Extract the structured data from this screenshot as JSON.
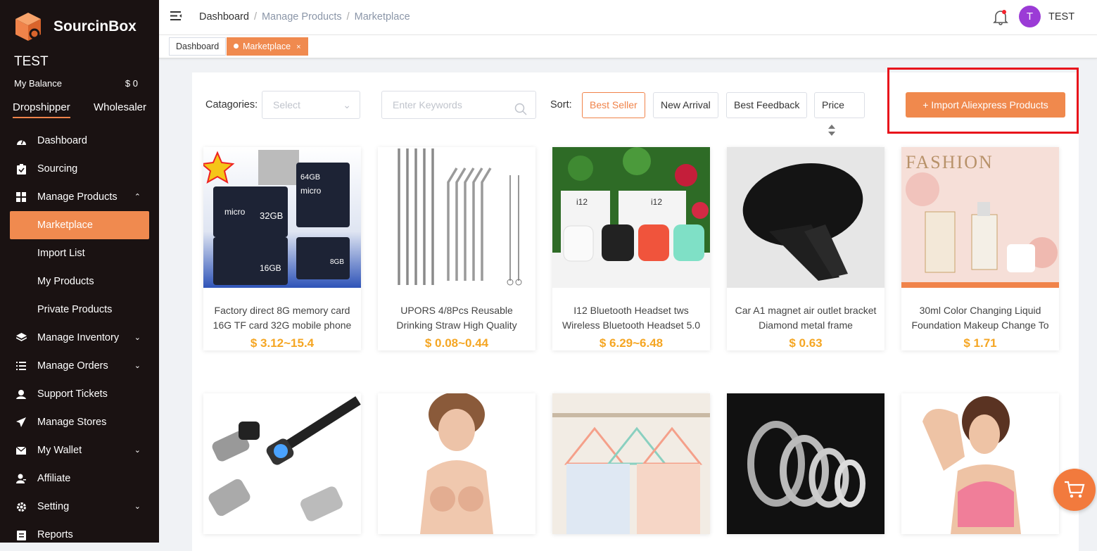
{
  "brand": {
    "name": "SourcinBox",
    "accent": "#f0834a"
  },
  "sidebar": {
    "user": "TEST",
    "balance_label": "My Balance",
    "balance_value": "$ 0",
    "roles": [
      "Dropshipper",
      "Wholesaler"
    ],
    "items": [
      {
        "label": "Dashboard",
        "icon": "dashboard-icon"
      },
      {
        "label": "Sourcing",
        "icon": "clipboard-icon"
      },
      {
        "label": "Manage Products",
        "icon": "grid-icon"
      },
      {
        "label": "Marketplace"
      },
      {
        "label": "Import List"
      },
      {
        "label": "My Products"
      },
      {
        "label": "Private Products"
      },
      {
        "label": "Manage Inventory",
        "icon": "layers-icon"
      },
      {
        "label": "Manage Orders",
        "icon": "list-icon"
      },
      {
        "label": "Support Tickets",
        "icon": "headset-icon"
      },
      {
        "label": "Manage Stores",
        "icon": "send-icon"
      },
      {
        "label": "My Wallet",
        "icon": "mail-icon"
      },
      {
        "label": "Affiliate",
        "icon": "user-icon"
      },
      {
        "label": "Setting",
        "icon": "gear-icon"
      },
      {
        "label": "Reports",
        "icon": "report-icon"
      }
    ]
  },
  "header": {
    "breadcrumb": [
      "Dashboard",
      "Manage Products",
      "Marketplace"
    ],
    "avatar_letter": "T",
    "user": "TEST"
  },
  "tabs": [
    {
      "label": "Dashboard"
    },
    {
      "label": "Marketplace",
      "close": "×"
    }
  ],
  "filters": {
    "categories_label": "Catagories:",
    "select_placeholder": "Select",
    "keywords_placeholder": "Enter Keywords",
    "sort_label": "Sort:",
    "sort_options": [
      "Best Seller",
      "New Arrival",
      "Best Feedback",
      "Price"
    ],
    "import_button": "+ Import Aliexpress Products"
  },
  "products": [
    {
      "title": "Factory direct 8G memory card 16G TF card 32G mobile phone",
      "price": "$ 3.12~15.4"
    },
    {
      "title": "UPORS 4/8Pcs Reusable Drinking Straw High Quality",
      "price": "$ 0.08~0.44"
    },
    {
      "title": "I12 Bluetooth Headset tws Wireless Bluetooth Headset 5.0",
      "price": "$ 6.29~6.48"
    },
    {
      "title": "Car A1 magnet air outlet bracket Diamond metal frame",
      "price": "$ 0.63"
    },
    {
      "title": "30ml Color Changing Liquid Foundation Makeup Change To",
      "price": "$ 1.71"
    }
  ]
}
